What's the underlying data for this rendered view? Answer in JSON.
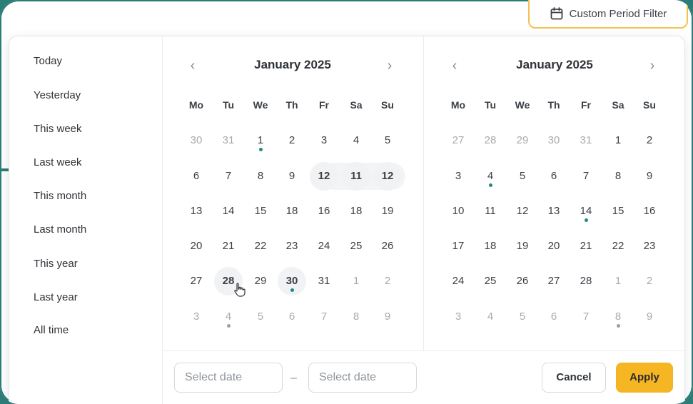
{
  "filter_button": {
    "label": "Custom Period Filter",
    "icon": "calendar-icon"
  },
  "presets": [
    "Today",
    "Yesterday",
    "This week",
    "Last week",
    "This month",
    "Last month",
    "This year",
    "Last year",
    "All time"
  ],
  "weekdays": [
    "Mo",
    "Tu",
    "We",
    "Th",
    "Fr",
    "Sa",
    "Su"
  ],
  "calendars": [
    {
      "title": "January 2025",
      "weeks": [
        [
          "30",
          "31",
          "1",
          "2",
          "3",
          "4",
          "5"
        ],
        [
          "6",
          "7",
          "8",
          "9",
          "12",
          "11",
          "12"
        ],
        [
          "13",
          "14",
          "15",
          "18",
          "16",
          "18",
          "19"
        ],
        [
          "20",
          "21",
          "22",
          "23",
          "24",
          "25",
          "26"
        ],
        [
          "27",
          "28",
          "29",
          "30",
          "31",
          "1",
          "2"
        ],
        [
          "3",
          "4",
          "5",
          "6",
          "7",
          "8",
          "9"
        ]
      ]
    },
    {
      "title": "January 2025",
      "weeks": [
        [
          "27",
          "28",
          "29",
          "30",
          "31",
          "1",
          "2"
        ],
        [
          "3",
          "4",
          "5",
          "6",
          "7",
          "8",
          "9"
        ],
        [
          "10",
          "11",
          "12",
          "13",
          "14",
          "15",
          "16"
        ],
        [
          "17",
          "18",
          "19",
          "20",
          "21",
          "22",
          "23"
        ],
        [
          "24",
          "25",
          "26",
          "27",
          "28",
          "1",
          "2"
        ],
        [
          "3",
          "4",
          "5",
          "6",
          "7",
          "8",
          "9"
        ]
      ]
    }
  ],
  "footer": {
    "start_placeholder": "Select date",
    "separator": "–",
    "end_placeholder": "Select date",
    "cancel_label": "Cancel",
    "apply_label": "Apply"
  },
  "colors": {
    "accent": "#1f8a84",
    "apply": "#f6b624",
    "focus_border": "#f2c14e"
  }
}
